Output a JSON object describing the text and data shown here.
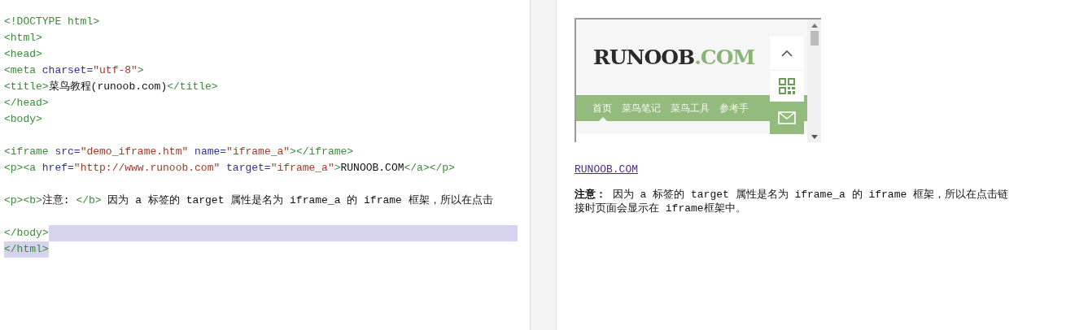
{
  "editor": {
    "lines": [
      {
        "kind": "code",
        "selected": false,
        "tokens": [
          {
            "kind": "tag",
            "text": "<!DOCTYPE html>"
          }
        ]
      },
      {
        "kind": "code",
        "selected": false,
        "tokens": [
          {
            "kind": "tag",
            "text": "<html>"
          }
        ]
      },
      {
        "kind": "code",
        "selected": false,
        "tokens": [
          {
            "kind": "tag",
            "text": "<head>"
          }
        ]
      },
      {
        "kind": "code",
        "selected": false,
        "tokens": [
          {
            "kind": "tag",
            "text": "<meta "
          },
          {
            "kind": "attr",
            "text": "charset="
          },
          {
            "kind": "value",
            "text": "\"utf-8\""
          },
          {
            "kind": "tag",
            "text": ">"
          }
        ]
      },
      {
        "kind": "code",
        "selected": false,
        "tokens": [
          {
            "kind": "tag",
            "text": "<title>"
          },
          {
            "kind": "text",
            "text": "菜鸟教程(runoob.com)"
          },
          {
            "kind": "tag",
            "text": "</title>"
          }
        ]
      },
      {
        "kind": "code",
        "selected": false,
        "tokens": [
          {
            "kind": "tag",
            "text": "</head>"
          }
        ]
      },
      {
        "kind": "code",
        "selected": false,
        "tokens": [
          {
            "kind": "tag",
            "text": "<body>"
          }
        ]
      },
      {
        "kind": "blank"
      },
      {
        "kind": "code",
        "selected": false,
        "tokens": [
          {
            "kind": "tag",
            "text": "<iframe "
          },
          {
            "kind": "attr",
            "text": "src="
          },
          {
            "kind": "value",
            "text": "\"demo_iframe.htm\" "
          },
          {
            "kind": "attr",
            "text": "name="
          },
          {
            "kind": "value",
            "text": "\"iframe_a\""
          },
          {
            "kind": "tag",
            "text": "></iframe>"
          }
        ]
      },
      {
        "kind": "code",
        "selected": false,
        "tokens": [
          {
            "kind": "tag",
            "text": "<p><a "
          },
          {
            "kind": "attr",
            "text": "href="
          },
          {
            "kind": "value",
            "text": "\"http://www.runoob.com\" "
          },
          {
            "kind": "attr",
            "text": "target="
          },
          {
            "kind": "value",
            "text": "\"iframe_a\""
          },
          {
            "kind": "tag",
            "text": ">"
          },
          {
            "kind": "text",
            "text": "RUNOOB.COM"
          },
          {
            "kind": "tag",
            "text": "</a></p>"
          }
        ]
      },
      {
        "kind": "blank"
      },
      {
        "kind": "code",
        "selected": false,
        "tokens": [
          {
            "kind": "tag",
            "text": "<p><b>"
          },
          {
            "kind": "text",
            "text": "注意: "
          },
          {
            "kind": "tag",
            "text": "</b>"
          },
          {
            "kind": "text",
            "text": " 因为 a 标签的 target 属性是名为 iframe_a 的 iframe 框架，所以在点击"
          }
        ]
      },
      {
        "kind": "blank"
      },
      {
        "kind": "code",
        "selected": true,
        "tokens": [
          {
            "kind": "tag",
            "text": "</body>"
          }
        ]
      },
      {
        "kind": "code",
        "selected": true,
        "tokens": [
          {
            "kind": "tag",
            "text": "</html>"
          }
        ]
      }
    ]
  },
  "preview": {
    "frame": {
      "logo": {
        "main": "RUNOOB",
        "accent": ".COM"
      },
      "nav": [
        {
          "label": "首页",
          "selected": true
        },
        {
          "label": "菜鸟笔记",
          "selected": false
        },
        {
          "label": "菜鸟工具",
          "selected": false
        },
        {
          "label": "参考手",
          "selected": false
        }
      ]
    },
    "link": "RUNOOB.COM",
    "note": "**注意：** 因为 a 标签的 target 属性是名为 iframe_a 的 iframe 框架，所以在点击链接时页面会显示在 iframe框架中。"
  }
}
